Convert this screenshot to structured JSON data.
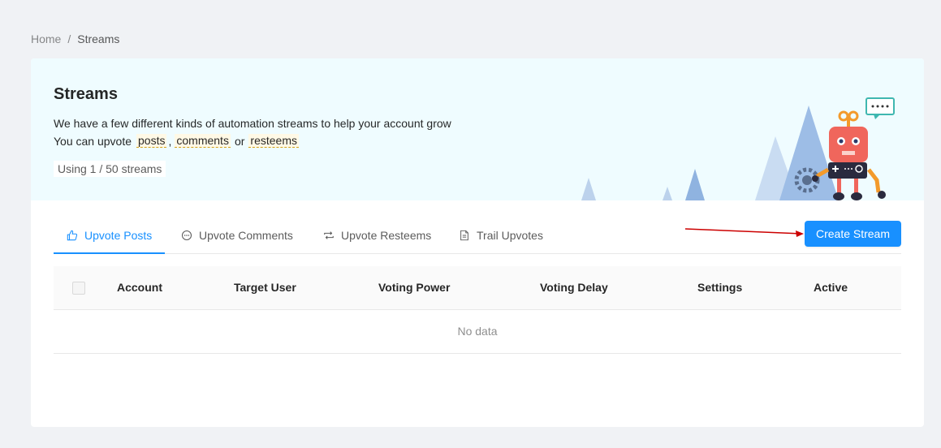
{
  "breadcrumb": {
    "home": "Home",
    "separator": "/",
    "current": "Streams"
  },
  "hero": {
    "title": "Streams",
    "line1": "We have a few different kinds of automation streams to help your account grow",
    "line2_prefix": "You can upvote",
    "tag_posts": "posts",
    "comma": ",",
    "tag_comments": "comments",
    "or": "or",
    "tag_resteems": "resteems",
    "usage": "Using 1 / 50 streams"
  },
  "tabs": [
    {
      "label": "Upvote Posts",
      "icon": "thumbs-up-icon",
      "active": true
    },
    {
      "label": "Upvote Comments",
      "icon": "message-icon",
      "active": false
    },
    {
      "label": "Upvote Resteems",
      "icon": "retweet-icon",
      "active": false
    },
    {
      "label": "Trail Upvotes",
      "icon": "file-text-icon",
      "active": false
    }
  ],
  "create_button": "Create Stream",
  "table": {
    "columns": [
      "Account",
      "Target User",
      "Voting Power",
      "Voting Delay",
      "Settings",
      "Active"
    ],
    "empty_text": "No data"
  },
  "colors": {
    "primary": "#1890ff",
    "hero_bg": "#effcff",
    "robot": "#f0665c",
    "arrow": "#cc0000"
  }
}
